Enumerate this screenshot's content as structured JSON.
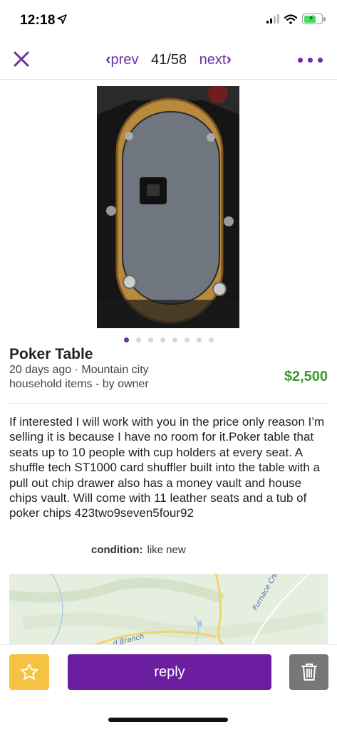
{
  "status": {
    "time": "12:18"
  },
  "nav": {
    "prev_label": "prev",
    "next_label": "next",
    "counter": "41/58"
  },
  "gallery": {
    "image_count": 8,
    "active_index": 0
  },
  "listing": {
    "title": "Poker Table",
    "posted_location": "20 days ago · Mountain city",
    "category": "household items - by owner",
    "price": "$2,500",
    "description": "If interested I will work with you in the price only reason I’m selling it is because I have no room for it.Poker table that seats up to 10 people with cup holders at every seat. A shuffle tech ST1000 card shuffler built into the table with a pull out chip drawer also has a money vault and house chips vault. Will come with 11 leather seats and a tub of poker chips 423two9seven5four92",
    "attributes": [
      {
        "key": "condition:",
        "value": "like new"
      }
    ]
  },
  "map": {
    "labels": [
      "Furnace Creek",
      "d Branch"
    ]
  },
  "actions": {
    "reply_label": "reply"
  },
  "colors": {
    "accent": "#6b2fa8",
    "reply": "#6b1fa0",
    "price": "#3c9a2a",
    "favorite": "#f5c242",
    "trash": "#777777"
  },
  "icons": [
    "location-arrow-icon",
    "signal-icon",
    "wifi-icon",
    "battery-icon",
    "close-icon",
    "chevron-left-icon",
    "chevron-right-icon",
    "more-icon",
    "star-icon",
    "trash-icon"
  ]
}
